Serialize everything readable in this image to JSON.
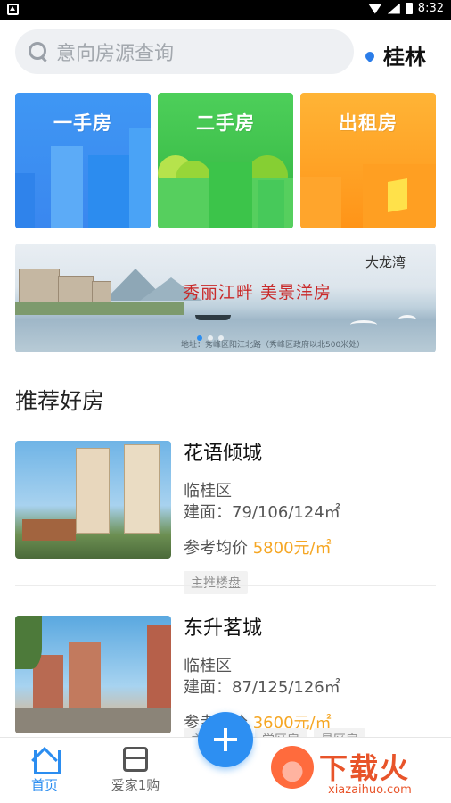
{
  "status_bar": {
    "time": "8:32"
  },
  "search": {
    "placeholder": "意向房源查询"
  },
  "location": {
    "city": "桂林"
  },
  "categories": [
    {
      "label": "一手房"
    },
    {
      "label": "二手房"
    },
    {
      "label": "出租房"
    }
  ],
  "banner": {
    "brand": "大龙湾",
    "slogan": "秀丽江畔  美景洋房",
    "address": "地址：秀峰区阳江北路（秀峰区政府以北500米处）"
  },
  "section": {
    "title": "推荐好房"
  },
  "listings": [
    {
      "name": "花语倾城",
      "district": "临桂区",
      "area": "建面：79/106/124㎡",
      "price_label": "参考均价",
      "price": "5800元/㎡",
      "tags": [
        "主推楼盘"
      ]
    },
    {
      "name": "东升茗城",
      "district": "临桂区",
      "area": "建面：87/125/126㎡",
      "price_label": "参考均价",
      "price": "3600元/㎡",
      "tags": [
        "主推楼盘",
        "学区房",
        "景区房"
      ]
    }
  ],
  "bottom_nav": {
    "items": [
      {
        "label": "首页",
        "icon": "home-icon",
        "active": true
      },
      {
        "label": "爱家1购",
        "icon": "shop-icon",
        "active": false
      }
    ],
    "fab_icon": "plus-icon"
  },
  "watermark": {
    "title": "下载火",
    "url": "xiazaihuo.com"
  },
  "colors": {
    "accent": "#2b8df0",
    "price": "#f5a623",
    "tag_bg": "#f2f2f2"
  }
}
